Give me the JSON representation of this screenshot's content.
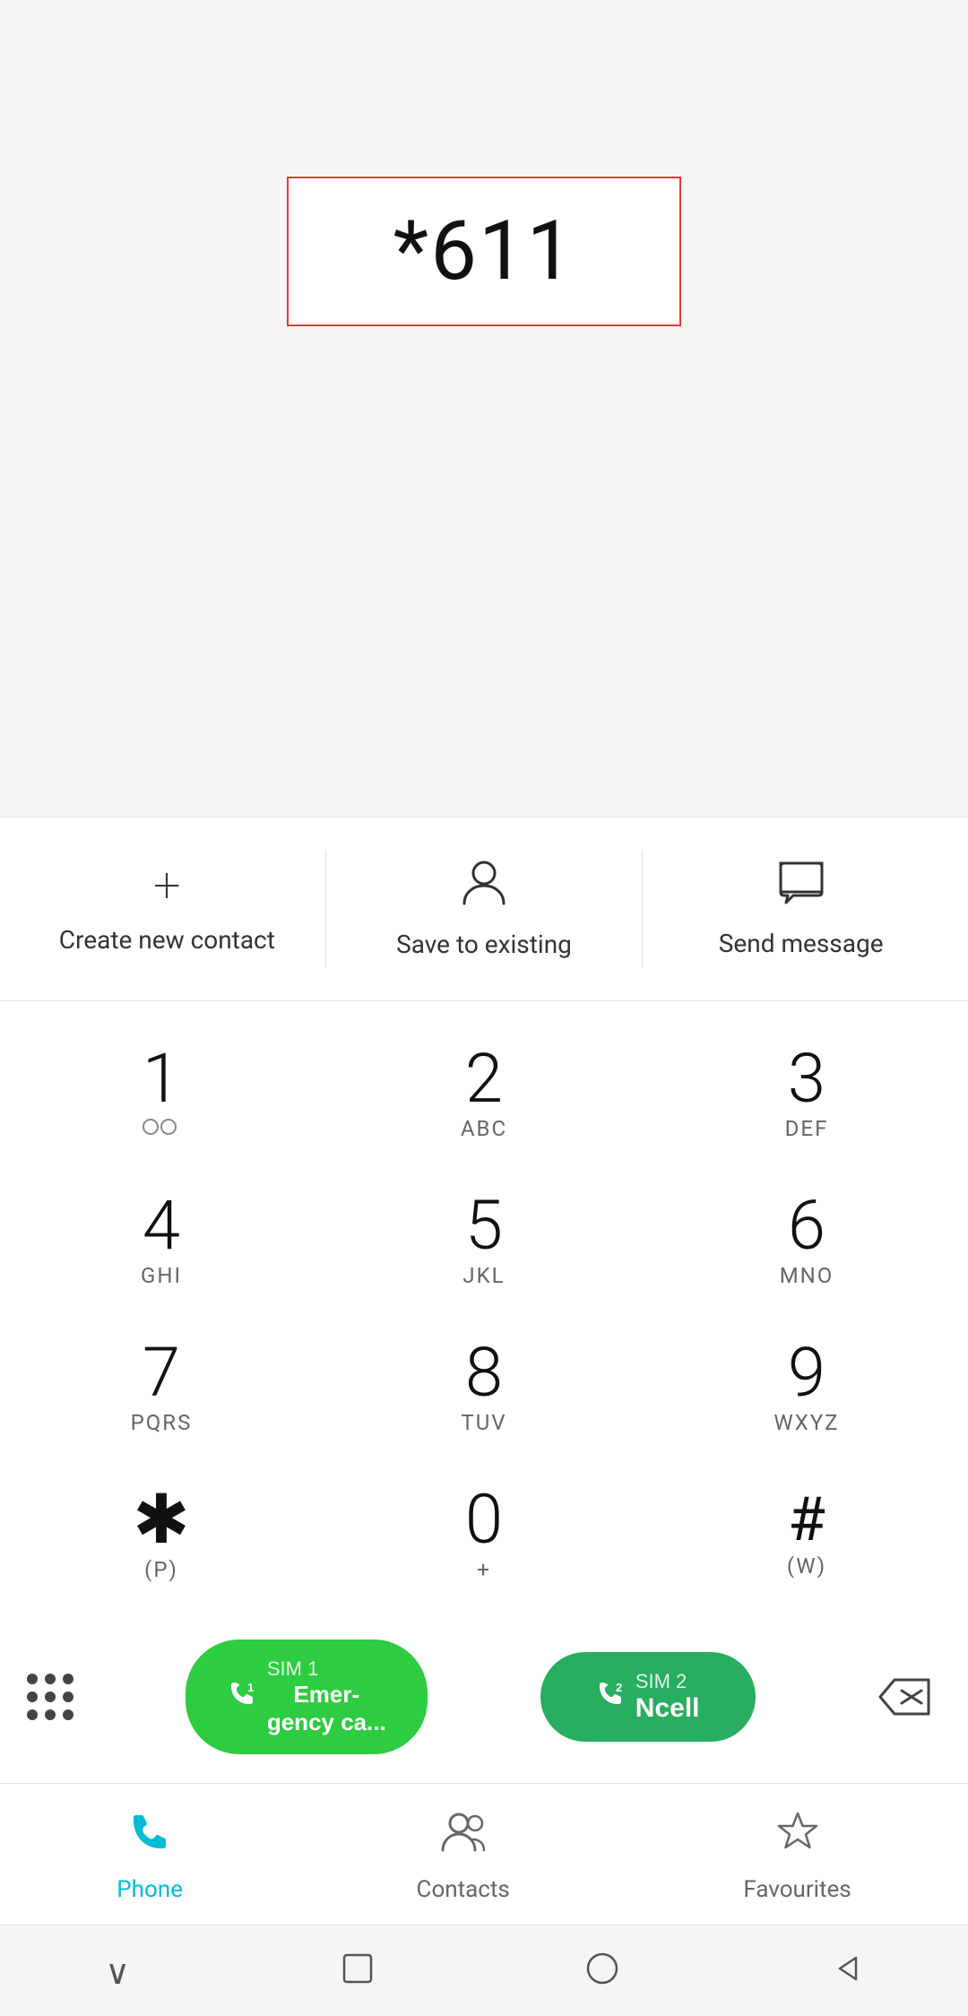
{
  "dialer": {
    "display_number": "*611"
  },
  "actions": [
    {
      "id": "create-new-contact",
      "icon": "plus",
      "label": "Create new contact"
    },
    {
      "id": "save-to-existing",
      "icon": "person",
      "label": "Save to existing"
    },
    {
      "id": "send-message",
      "icon": "message",
      "label": "Send message"
    }
  ],
  "keypad": [
    {
      "digit": "1",
      "letters": "◌◌",
      "id": "key-1"
    },
    {
      "digit": "2",
      "letters": "ABC",
      "id": "key-2"
    },
    {
      "digit": "3",
      "letters": "DEF",
      "id": "key-3"
    },
    {
      "digit": "4",
      "letters": "GHI",
      "id": "key-4"
    },
    {
      "digit": "5",
      "letters": "JKL",
      "id": "key-5"
    },
    {
      "digit": "6",
      "letters": "MNO",
      "id": "key-6"
    },
    {
      "digit": "7",
      "letters": "PQRS",
      "id": "key-7"
    },
    {
      "digit": "8",
      "letters": "TUV",
      "id": "key-8"
    },
    {
      "digit": "9",
      "letters": "WXYZ",
      "id": "key-9"
    },
    {
      "digit": "*",
      "letters": "(P)",
      "id": "key-star"
    },
    {
      "digit": "0",
      "letters": "+",
      "id": "key-0"
    },
    {
      "digit": "#",
      "letters": "(W)",
      "id": "key-hash"
    }
  ],
  "bottom_actions": {
    "emergency": {
      "sim": "1",
      "name": "Emer-\ngency ca..."
    },
    "ncell": {
      "sim": "2",
      "name": "Ncell"
    }
  },
  "nav": {
    "items": [
      {
        "id": "phone",
        "label": "Phone",
        "active": true
      },
      {
        "id": "contacts",
        "label": "Contacts",
        "active": false
      },
      {
        "id": "favourites",
        "label": "Favourites",
        "active": false
      }
    ]
  },
  "system_nav": {
    "back": "◁",
    "home": "○",
    "recents": "□",
    "down": "∨"
  }
}
